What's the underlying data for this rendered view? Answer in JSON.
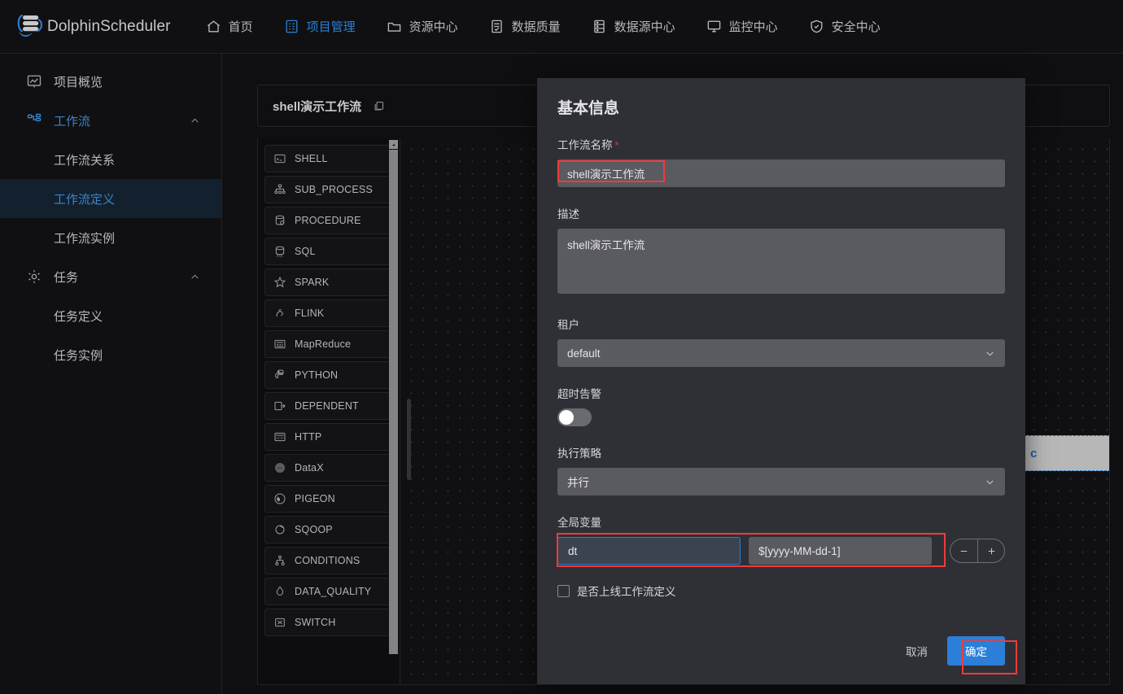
{
  "app": {
    "brand": "DolphinScheduler",
    "nav": [
      {
        "label": "首页",
        "icon": "home-icon",
        "active": false
      },
      {
        "label": "项目管理",
        "icon": "project-icon",
        "active": true
      },
      {
        "label": "资源中心",
        "icon": "folder-icon",
        "active": false
      },
      {
        "label": "数据质量",
        "icon": "quality-icon",
        "active": false
      },
      {
        "label": "数据源中心",
        "icon": "datasource-icon",
        "active": false
      },
      {
        "label": "监控中心",
        "icon": "monitor-icon",
        "active": false
      },
      {
        "label": "安全中心",
        "icon": "shield-icon",
        "active": false
      }
    ]
  },
  "sidebar": {
    "items": [
      {
        "label": "项目概览",
        "icon": "overview-icon",
        "type": "top",
        "active": false
      },
      {
        "label": "工作流",
        "icon": "workflow-icon",
        "type": "group",
        "expanded": true
      },
      {
        "label": "工作流关系",
        "type": "sub",
        "active": false
      },
      {
        "label": "工作流定义",
        "type": "sub",
        "active": true
      },
      {
        "label": "工作流实例",
        "type": "sub",
        "active": false
      },
      {
        "label": "任务",
        "icon": "gear-icon",
        "type": "group",
        "expanded": true
      },
      {
        "label": "任务定义",
        "type": "sub",
        "active": false
      },
      {
        "label": "任务实例",
        "type": "sub",
        "active": false
      }
    ]
  },
  "workflow_header": {
    "title": "shell演示工作流",
    "copy_icon": "copy-icon"
  },
  "palette": {
    "tasks": [
      {
        "label": "SHELL",
        "icon": "terminal-icon"
      },
      {
        "label": "SUB_PROCESS",
        "icon": "subprocess-icon"
      },
      {
        "label": "PROCEDURE",
        "icon": "procedure-icon"
      },
      {
        "label": "SQL",
        "icon": "sql-icon"
      },
      {
        "label": "SPARK",
        "icon": "spark-icon"
      },
      {
        "label": "FLINK",
        "icon": "flink-icon"
      },
      {
        "label": "MapReduce",
        "icon": "mapreduce-icon"
      },
      {
        "label": "PYTHON",
        "icon": "python-icon"
      },
      {
        "label": "DEPENDENT",
        "icon": "dependent-icon"
      },
      {
        "label": "HTTP",
        "icon": "http-icon"
      },
      {
        "label": "DataX",
        "icon": "datax-icon"
      },
      {
        "label": "PIGEON",
        "icon": "pigeon-icon"
      },
      {
        "label": "SQOOP",
        "icon": "sqoop-icon"
      },
      {
        "label": "CONDITIONS",
        "icon": "conditions-icon"
      },
      {
        "label": "DATA_QUALITY",
        "icon": "dataquality-icon"
      },
      {
        "label": "SWITCH",
        "icon": "switch-icon"
      }
    ]
  },
  "canvas": {
    "node_label": "c",
    "node_add_icon": "plus-circle-icon"
  },
  "modal": {
    "title": "基本信息",
    "name": {
      "label": "工作流名称",
      "required_marker": "*",
      "value": "shell演示工作流"
    },
    "description": {
      "label": "描述",
      "value": "shell演示工作流"
    },
    "tenant": {
      "label": "租户",
      "value": "default",
      "chevron_icon": "chevron-down-icon"
    },
    "timeout_alert": {
      "label": "超时告警",
      "enabled": false
    },
    "execution_policy": {
      "label": "执行策略",
      "value": "并行",
      "chevron_icon": "chevron-down-icon"
    },
    "global_params": {
      "label": "全局变量",
      "rows": [
        {
          "key": "dt",
          "value": "$[yyyy-MM-dd-1]"
        }
      ],
      "remove_icon": "minus-icon",
      "add_icon": "plus-icon"
    },
    "online_checkbox": {
      "label": "是否上线工作流定义",
      "checked": false
    },
    "footer": {
      "cancel": "取消",
      "confirm": "确定"
    }
  },
  "colors": {
    "accent_blue": "#2b7fd8",
    "annotation_red": "#ef3b3b",
    "modal_bg": "#2f3036",
    "input_bg": "#5a5a61",
    "page_bg": "#0f0f11"
  }
}
